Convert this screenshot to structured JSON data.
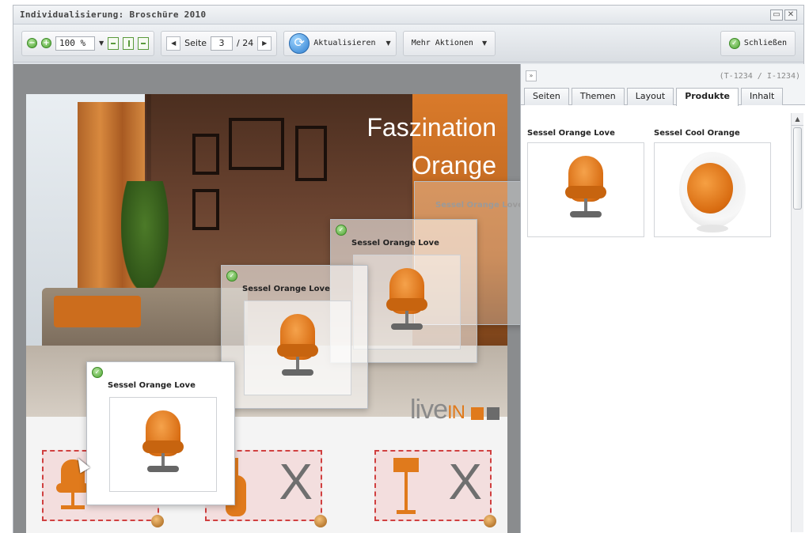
{
  "window": {
    "title": "Individualisierung: Broschüre 2010",
    "controls": [
      "maximize-icon",
      "close-icon"
    ]
  },
  "toolbar": {
    "zoom_out_icon": "zoom-out-icon",
    "zoom_in_icon": "zoom-in-icon",
    "zoom_value": "100 %",
    "fit_icons": [
      "fit-width-icon",
      "fit-height-icon",
      "fit-page-icon"
    ],
    "page_label": "Seite",
    "page_current": "3",
    "page_total": "/ 24",
    "refresh_label": "Aktualisieren",
    "more_actions_label": "Mehr Aktionen",
    "close_label": "Schließen"
  },
  "canvas": {
    "headline_line1": "Faszination",
    "headline_line2": "Orange",
    "logo_text_live": "live",
    "logo_text_in": "IN",
    "logo_colors": [
      "#e07a1c",
      "#6b6b6b"
    ],
    "slots": [
      {
        "x": "X"
      },
      {
        "x": "X"
      },
      {
        "x": "X"
      }
    ],
    "overlays": [
      {
        "label": "Sessel Orange Love"
      },
      {
        "label": "Sessel Orange Love"
      },
      {
        "label": "Sessel Orange Love"
      },
      {
        "label": "Sessel Orange Love"
      }
    ]
  },
  "sidebar": {
    "ids": "(T-1234 / I-1234)",
    "tabs": [
      {
        "label": "Seiten"
      },
      {
        "label": "Themen"
      },
      {
        "label": "Layout"
      },
      {
        "label": "Produkte",
        "active": true
      },
      {
        "label": "Inhalt"
      }
    ],
    "products": [
      {
        "name": "Sessel Orange Love",
        "image": "orange-swivel-chair"
      },
      {
        "name": "Sessel Cool Orange",
        "image": "orange-ball-chair"
      }
    ]
  },
  "colors": {
    "accent_orange": "#e07a1c",
    "ok_green": "#4aa22f",
    "slot_border": "#d04040"
  }
}
